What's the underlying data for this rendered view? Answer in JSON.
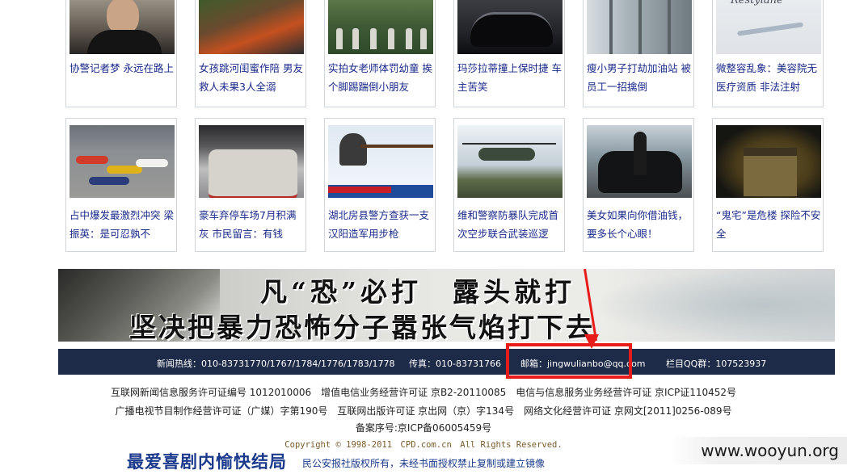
{
  "news_cards": [
    {
      "caption": "协警记者梦 永远在路上"
    },
    {
      "caption": "女孩跳河闺蜜作陪 男友救人未果3人全溺"
    },
    {
      "caption": "实拍女老师体罚幼童 挨个脚踢踹倒小朋友"
    },
    {
      "caption": "玛莎拉蒂撞上保时捷 车主苦笑"
    },
    {
      "caption": "瘦小男子打劫加油站 被员工一招擒倒"
    },
    {
      "caption": "微整容乱象：美容院无医疗资质 非法注射"
    },
    {
      "caption": "占中爆发最激烈冲突 梁振英：是可忍孰不"
    },
    {
      "caption": "豪车弃停车场7月积满灰 市民留言：有钱"
    },
    {
      "caption": "湖北房县警方查获一支汉阳造军用步枪"
    },
    {
      "caption": "维和警察防暴队完成首次空步联合武装巡逻"
    },
    {
      "caption": "美女如果向你借油钱，要多长个心眼！"
    },
    {
      "caption": "“鬼宅”是危楼 探险不安全"
    }
  ],
  "thumb_text": {
    "card6_title": "Restylane"
  },
  "banner": {
    "line1": "凡“恐”必打　露头就打",
    "line2": "坚决把暴力恐怖分子嚣张气焰打下去"
  },
  "contact": {
    "hotline": "新闻热线：010-83731770/1767/1784/1776/1783/1778",
    "fax": "传真：010-83731766",
    "email": "邮箱：jingwulianbo@qq.com",
    "qq_group": "栏目QQ群：107523937"
  },
  "footer": {
    "line1": "互联网新闻信息服务许可证编号 1012010006　增值电信业务经营许可证 京B2-20110085　电信与信息服务业务经营许可证 京ICP证110452号",
    "line2": "广播电视节目制作经营许可证（广媒）字第190号　互联网出版许可证 京出网（京）字134号　网络文化经营许可证 京网文[2011]0256-089号",
    "line3": "备案序号:京ICP备06005459号",
    "copyright": "Copyright © 1998-2011　CPD.com.cn　All Rights Reserved.",
    "notice": "民公安报社版权所有，未经书面授权禁止复制或建立镜像"
  },
  "overlay_title": "最爱喜剧内愉快结局",
  "watermark": "www.wooyun.org",
  "colors": {
    "annotation_red": "#e81b1b",
    "contact_bar": "#1e2b48",
    "caption_blue": "#1a2a8a"
  }
}
